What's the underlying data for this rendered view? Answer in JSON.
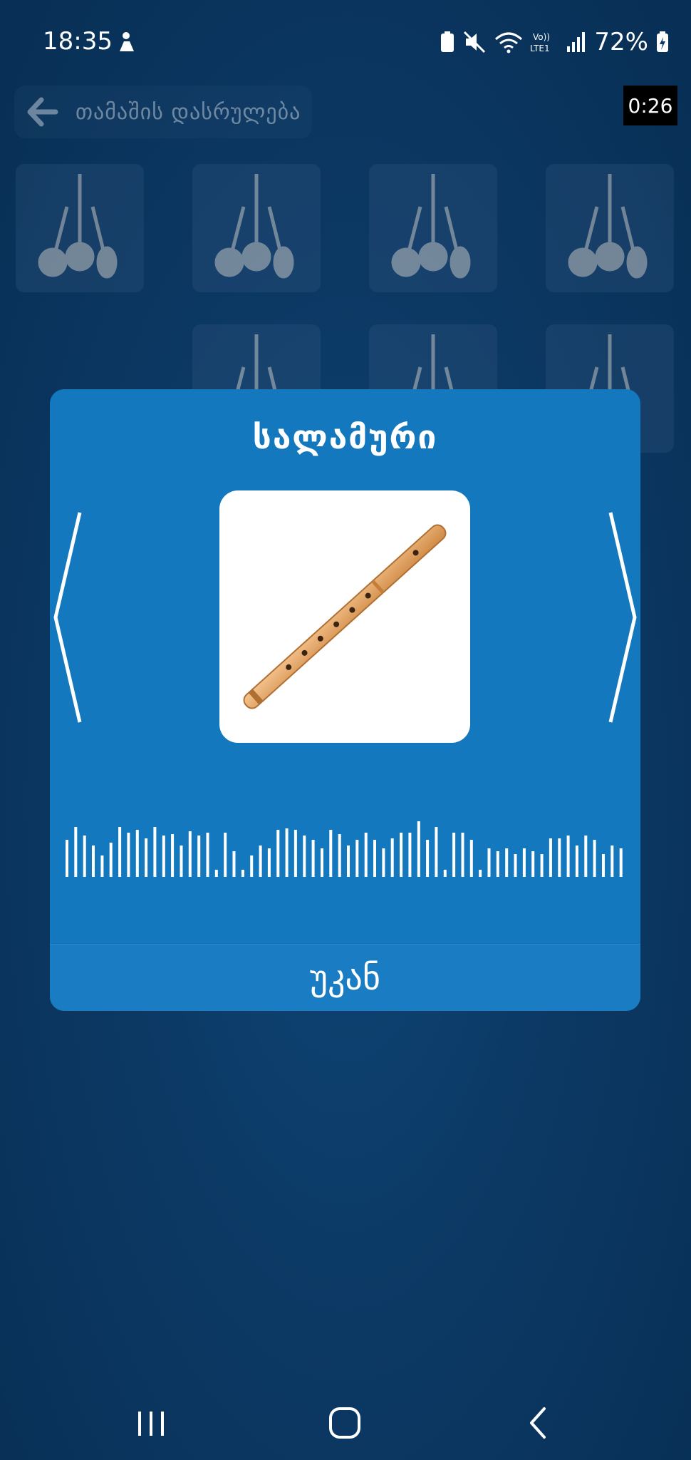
{
  "status_bar": {
    "time": "18:35",
    "battery": "72%"
  },
  "top": {
    "back_label": "თამაშის დასრულება",
    "timer": "0:26"
  },
  "dialog": {
    "title": "სალამური",
    "back_button": "უკან",
    "image_icon": "salamuri-flute-image",
    "prev_icon": "chevron-left-icon",
    "next_icon": "chevron-right-icon"
  },
  "grid": {
    "card_icon": "string-instruments-icon",
    "rows": [
      {
        "cards": [
          1,
          1,
          1,
          1
        ]
      },
      {
        "cards": [
          0,
          1,
          1,
          1
        ]
      }
    ]
  },
  "nav_bar": {
    "recent_icon": "recent-apps-icon",
    "home_icon": "home-icon",
    "back_icon": "back-icon"
  },
  "colors": {
    "background": "#0c3a66",
    "dialog": "#1378be",
    "text": "#ffffff"
  }
}
